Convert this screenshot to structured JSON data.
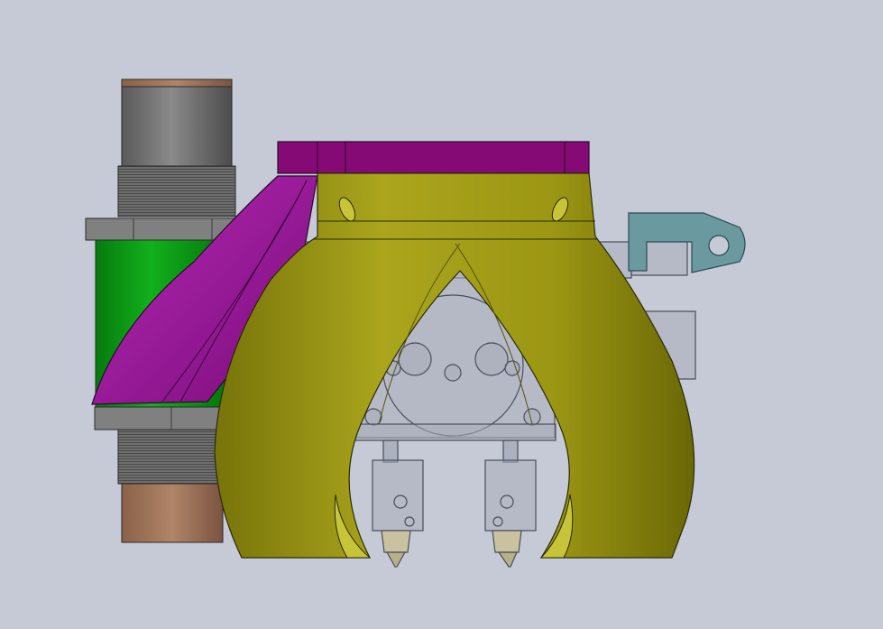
{
  "scene": {
    "background": "#c6cad6"
  },
  "parts": {
    "sensor_cylinder": {
      "body": "#6a6a6a",
      "cap": "#9a7258",
      "nut": "#7d7d7d"
    },
    "led_ring": {
      "color": "#0a9a14"
    },
    "fan_duct": {
      "color": "#a51ea5",
      "shade": "#6e0a6e"
    },
    "top_mount": {
      "color": "#8a0a7a",
      "shade": "#5e045a"
    },
    "shroud": {
      "color": "#a6a11a",
      "shade": "#6e6b08",
      "light": "#b8b42a"
    },
    "clip": {
      "color": "#6a9aa0"
    },
    "hotend": {
      "glass": "#9aa0ae",
      "line": "#4a4e58",
      "nozzle": "#c8c0a0"
    }
  }
}
